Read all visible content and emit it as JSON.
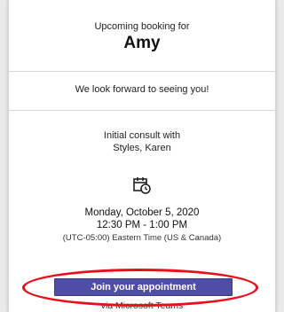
{
  "header": {
    "upcoming_label": "Upcoming booking for",
    "name": "Amy"
  },
  "message": "We look forward to seeing you!",
  "consult": {
    "line1": "Initial consult with",
    "line2": "Styles, Karen"
  },
  "icons": {
    "calendar": "calendar-clock-icon"
  },
  "schedule": {
    "date": "Monday, October 5, 2020",
    "time": "12:30 PM - 1:00 PM",
    "timezone": "(UTC-05:00) Eastern Time (US & Canada)"
  },
  "join": {
    "label": "Join your appointment",
    "via": "via Microsoft Teams"
  },
  "colors": {
    "button": "#4f4ea6",
    "highlight": "#e8101c",
    "card": "#ffffff"
  }
}
